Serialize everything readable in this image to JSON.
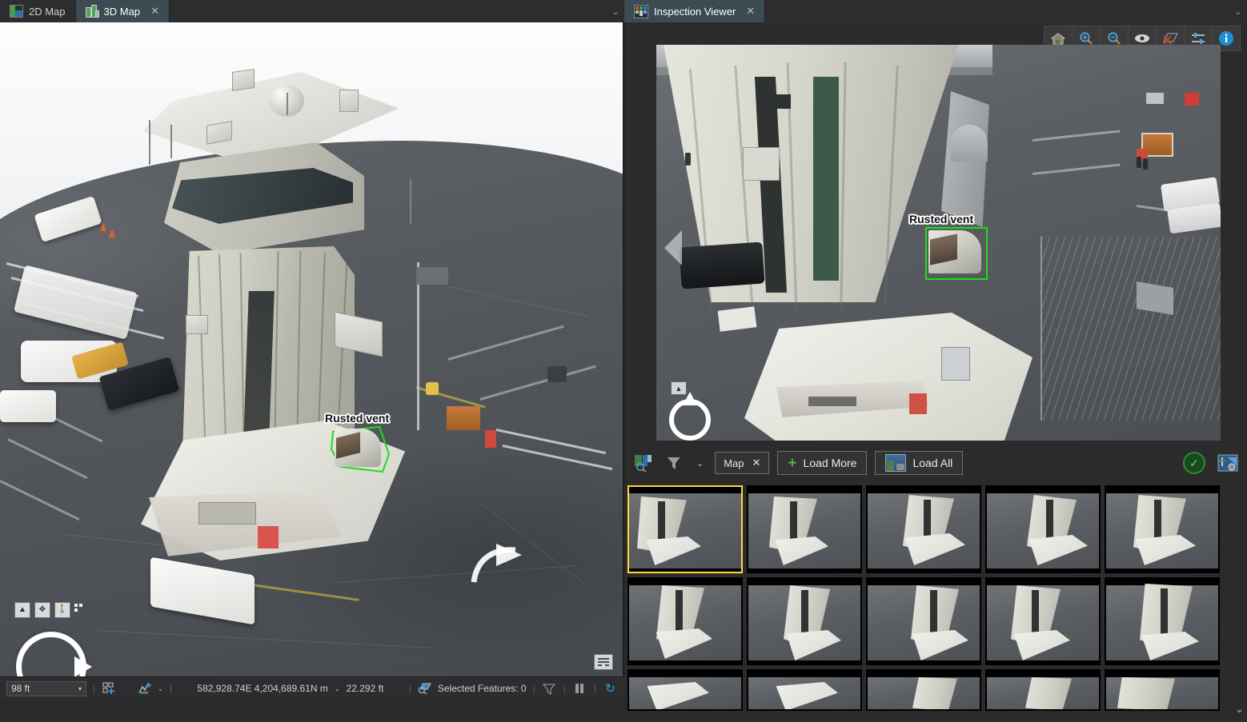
{
  "tabs_left": [
    {
      "label": "2D Map",
      "icon": "map-2d-icon",
      "active": false,
      "closable": false
    },
    {
      "label": "3D Map",
      "icon": "map-3d-icon",
      "active": true,
      "closable": true,
      "close": "✕"
    }
  ],
  "tabs_right": [
    {
      "label": "Inspection Viewer",
      "icon": "inspection-viewer-icon",
      "active": true,
      "closable": true,
      "close": "✕"
    }
  ],
  "tab_overflow_chevron": "⌄",
  "map3d": {
    "annotation": {
      "label": "Rusted vent",
      "color": "#19e019"
    },
    "nav_buttons": [
      {
        "name": "collapse-nav-button",
        "glyph": "▲"
      },
      {
        "name": "pan-tool-button",
        "glyph": "✥"
      },
      {
        "name": "walk-tool-button",
        "glyph": "Ὣ6"
      }
    ],
    "compass_name": "compass-widget",
    "legend_button_name": "legend-button"
  },
  "inspection": {
    "toolbar": [
      {
        "name": "home-icon",
        "title": "Home"
      },
      {
        "name": "zoom-in-icon",
        "title": "Zoom In"
      },
      {
        "name": "zoom-out-icon",
        "title": "Zoom Out"
      },
      {
        "name": "eye-icon",
        "title": "Visibility"
      },
      {
        "name": "delete-shape-icon",
        "title": "Delete"
      },
      {
        "name": "settings-sliders-icon",
        "title": "Settings"
      },
      {
        "name": "info-icon",
        "title": "Information"
      }
    ],
    "annotation": {
      "label": "Rusted vent",
      "color": "#19e019"
    },
    "prev_arrow": "◀",
    "next_arrow": "▶",
    "bottombar": {
      "source_icon": "map-source-icon",
      "filter_icon": "filter-icon",
      "filter_chevron": "⌄",
      "chip_label": "Map",
      "chip_close": "✕",
      "load_more_label": "Load More",
      "load_more_plus": "+",
      "load_all_label": "Load All",
      "load_all_icon": "image-icon",
      "accept_icon": "check-circle-icon",
      "accept_glyph": "✓",
      "capture_icon": "image-capture-icon"
    },
    "thumbnails": {
      "selected_index": 0,
      "count": 15,
      "more_chevron": "⌄"
    }
  },
  "statusbar": {
    "scale": "98 ft",
    "scale_caret": "▾",
    "icons": [
      {
        "name": "add-layer-icon"
      },
      {
        "name": "grid-icon"
      },
      {
        "name": "add-point-icon"
      }
    ],
    "tools_caret": "⌄",
    "coordinates": "582,928.74E 4,204,689.61N m",
    "coord_caret": "⌄",
    "elevation": "22.292 ft",
    "selected_features": "Selected Features: 0",
    "selection_icon": "select-features-icon",
    "clip_icon": "clip-icon",
    "pause_icon": "pause-icon",
    "refresh_icon": "refresh-icon",
    "refresh_glyph": "↻",
    "divider": "|"
  },
  "colors": {
    "accent_green": "#19e019",
    "selection_yellow": "#ffd83b",
    "active_tab": "#3c4a52",
    "panel_bg": "#2b2b2b"
  }
}
